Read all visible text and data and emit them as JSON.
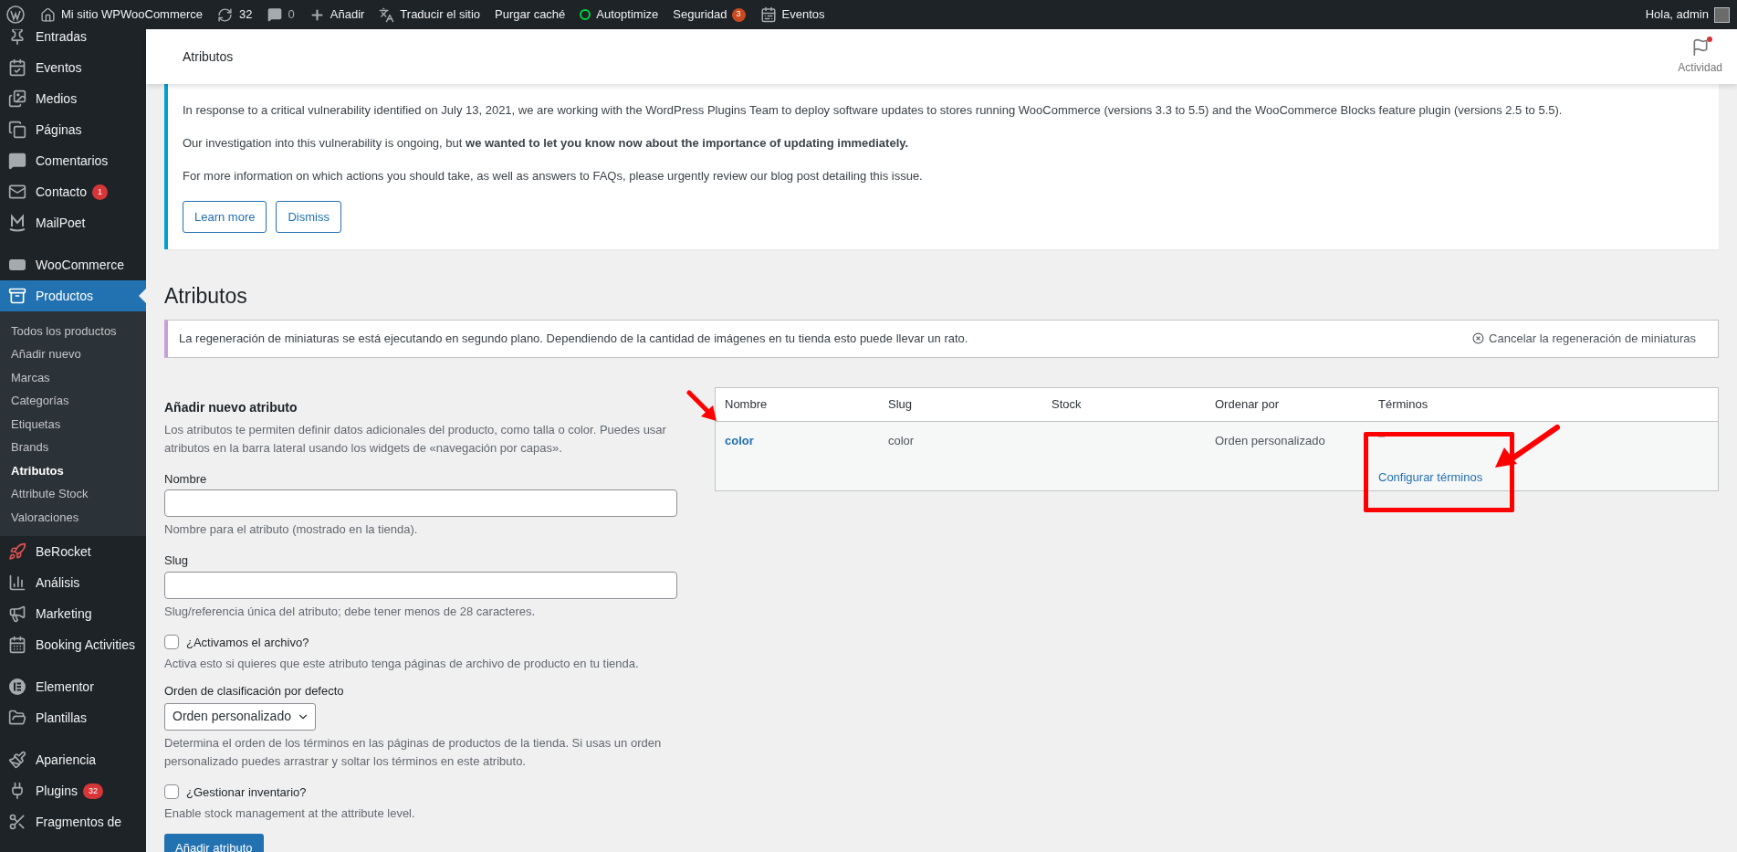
{
  "admin_bar": {
    "site": "Mi sitio WPWooCommerce",
    "updates": "32",
    "comments": "0",
    "new": "Añadir",
    "translate": "Traducir el sitio",
    "cache": "Purgar caché",
    "autoptimize": "Autoptimize",
    "security": {
      "label": "Seguridad",
      "badge": "3"
    },
    "events": "Eventos",
    "account": "Hola, admin"
  },
  "sidebar": {
    "groups": [
      [
        {
          "label": "Entradas",
          "selected": false
        },
        {
          "label": "Eventos",
          "selected": false
        },
        {
          "label": "Medios",
          "selected": false
        },
        {
          "label": "Páginas",
          "selected": false
        },
        {
          "label": "Comentarios",
          "selected": false
        },
        {
          "label": "Contacto",
          "badge": "1",
          "selected": false
        },
        {
          "label": "MailPoet",
          "selected": false
        }
      ],
      [
        {
          "label": "WooCommerce",
          "selected": false
        },
        {
          "label": "Productos",
          "selected": true,
          "children": [
            {
              "label": "Todos los productos",
              "selected": false
            },
            {
              "label": "Añadir nuevo",
              "selected": false
            },
            {
              "label": "Marcas",
              "selected": false
            },
            {
              "label": "Categorías",
              "selected": false
            },
            {
              "label": "Etiquetas",
              "selected": false
            },
            {
              "label": "Brands",
              "selected": false
            },
            {
              "label": "Atributos",
              "selected": true
            },
            {
              "label": "Attribute Stock",
              "selected": false
            },
            {
              "label": "Valoraciones",
              "selected": false
            }
          ]
        },
        {
          "label": "BeRocket",
          "selected": false
        },
        {
          "label": "Análisis",
          "selected": false
        },
        {
          "label": "Marketing",
          "selected": false
        },
        {
          "label": "Booking Activities",
          "selected": false
        }
      ],
      [
        {
          "label": "Elementor",
          "selected": false
        },
        {
          "label": "Plantillas",
          "selected": false
        }
      ],
      [
        {
          "label": "Apariencia",
          "selected": false
        },
        {
          "label": "Plugins",
          "badge": "32",
          "selected": false
        },
        {
          "label": "Fragmentos de",
          "selected": false
        }
      ]
    ]
  },
  "header": {
    "title": "Atributos",
    "activity": "Actividad",
    "unread": true
  },
  "notice": {
    "paragraphs": [
      "In response to a critical vulnerability identified on July 13, 2021, we are working with the WordPress Plugins Team to deploy software updates to stores running WooCommerce (versions 3.3 to 5.5) and the WooCommerce Blocks feature plugin (versions 2.5 to 5.5).",
      "Our investigation into this vulnerability is ongoing, but **we wanted to let you know now about the importance of updating immediately.**",
      "For more information on which actions you should take, as well as answers to FAQs, please urgently review our blog post detailing this issue."
    ],
    "buttons": [
      "Learn more",
      "Dismiss"
    ]
  },
  "page_title": "Atributos",
  "info_notice": {
    "text": "La regeneración de miniaturas se está ejecutando en segundo plano. Dependiendo de la cantidad de imágenes en tu tienda esto puede llevar un rato.",
    "action": "Cancelar la regeneración de miniaturas"
  },
  "form": {
    "heading": "Añadir nuevo atributo",
    "intro": "Los atributos te permiten definir datos adicionales del producto, como talla o color. Puedes usar atributos en la barra lateral usando los widgets de «navegación por capas».",
    "fields": [
      {
        "kind": "text",
        "label": "Nombre",
        "help": "Nombre para el atributo (mostrado en la tienda)."
      },
      {
        "kind": "text",
        "label": "Slug",
        "help": "Slug/referencia única del atributo; debe tener menos de 28 caracteres."
      },
      {
        "kind": "checkbox",
        "label": "¿Activamos el archivo?",
        "checked": false,
        "help": "Activa esto si quieres que este atributo tenga páginas de archivo de producto en tu tienda."
      },
      {
        "kind": "select",
        "label": "Orden de clasificación por defecto",
        "value": "Orden personalizado",
        "help": "Determina el orden de los términos en las páginas de productos de la tienda. Si usas un orden personalizado puedes arrastrar y soltar los términos en este atributo."
      },
      {
        "kind": "checkbox",
        "label": "¿Gestionar inventario?",
        "checked": false,
        "help": "Enable stock management at the attribute level."
      }
    ],
    "submit": "Añadir atributo"
  },
  "table": {
    "columns": [
      "Nombre",
      "Slug",
      "Stock",
      "Ordenar por",
      "Términos"
    ],
    "rows": [
      {
        "name": "color",
        "slug": "color",
        "order_by": "Orden personalizado",
        "terms": "–",
        "terms_action": "Configurar términos"
      }
    ]
  }
}
